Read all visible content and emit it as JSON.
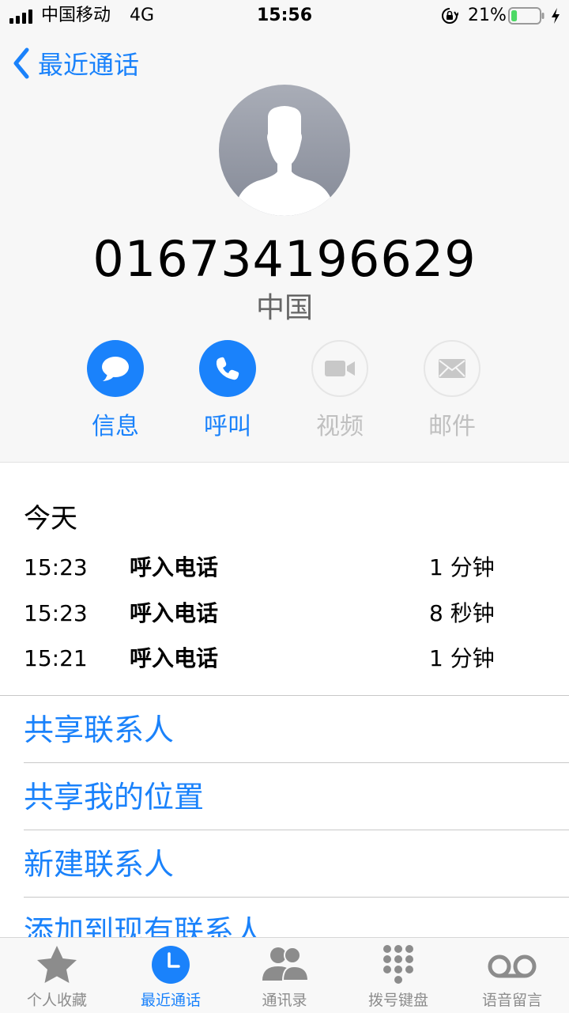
{
  "status_bar": {
    "carrier": "中国移动",
    "network": "4G",
    "time": "15:56",
    "battery_percent": "21%",
    "battery_level": 0.21
  },
  "nav": {
    "back_label": "最近通话"
  },
  "contact": {
    "phone_number": "016734196629",
    "location": "中国"
  },
  "actions": [
    {
      "label": "信息",
      "icon": "message-bubble-icon",
      "enabled": true
    },
    {
      "label": "呼叫",
      "icon": "phone-icon",
      "enabled": true
    },
    {
      "label": "视频",
      "icon": "video-camera-icon",
      "enabled": false
    },
    {
      "label": "邮件",
      "icon": "envelope-icon",
      "enabled": false
    }
  ],
  "history": {
    "title": "今天",
    "rows": [
      {
        "time": "15:23",
        "kind": "呼入电话",
        "duration": "1 分钟"
      },
      {
        "time": "15:23",
        "kind": "呼入电话",
        "duration": "8 秒钟"
      },
      {
        "time": "15:21",
        "kind": "呼入电话",
        "duration": "1 分钟"
      }
    ]
  },
  "menu": [
    {
      "label": "共享联系人"
    },
    {
      "label": "共享我的位置"
    },
    {
      "label": "新建联系人"
    },
    {
      "label": "添加到现有联系人"
    }
  ],
  "tab_bar": {
    "tabs": [
      {
        "label": "个人收藏",
        "icon": "star-icon",
        "active": false
      },
      {
        "label": "最近通话",
        "icon": "clock-icon",
        "active": true
      },
      {
        "label": "通讯录",
        "icon": "contacts-icon",
        "active": false
      },
      {
        "label": "拨号键盘",
        "icon": "keypad-icon",
        "active": false
      },
      {
        "label": "语音留言",
        "icon": "voicemail-icon",
        "active": false
      }
    ]
  },
  "colors": {
    "accent": "#1a82fb",
    "battery": "#4cd964"
  }
}
